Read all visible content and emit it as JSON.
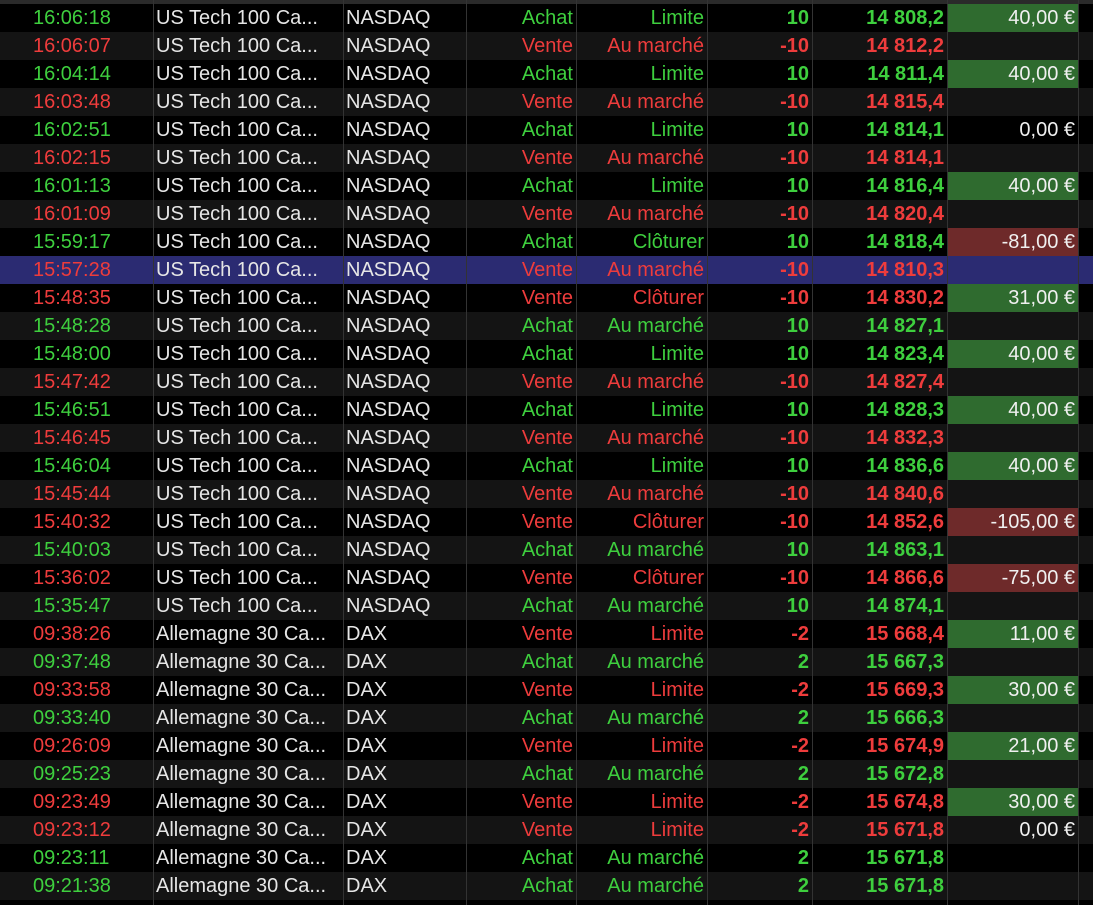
{
  "colors": {
    "buy": "#3ecf3e",
    "sell": "#ee3c3c",
    "profit_bg": "#2f6b2f",
    "loss_bg": "#6e2a2a",
    "selected_row": "#2b2b72"
  },
  "selected_row": 9,
  "rows": [
    {
      "time": "16:06:18",
      "instrument": "US Tech 100 Ca...",
      "market": "NASDAQ",
      "side": "Achat",
      "order_type": "Limite",
      "qty": "10",
      "price": "14 808,2",
      "pnl": "40,00 €",
      "pnl_style": "pos"
    },
    {
      "time": "16:06:07",
      "instrument": "US Tech 100 Ca...",
      "market": "NASDAQ",
      "side": "Vente",
      "order_type": "Au marché",
      "qty": "-10",
      "price": "14 812,2",
      "pnl": "",
      "pnl_style": "none"
    },
    {
      "time": "16:04:14",
      "instrument": "US Tech 100 Ca...",
      "market": "NASDAQ",
      "side": "Achat",
      "order_type": "Limite",
      "qty": "10",
      "price": "14 811,4",
      "pnl": "40,00 €",
      "pnl_style": "pos"
    },
    {
      "time": "16:03:48",
      "instrument": "US Tech 100 Ca...",
      "market": "NASDAQ",
      "side": "Vente",
      "order_type": "Au marché",
      "qty": "-10",
      "price": "14 815,4",
      "pnl": "",
      "pnl_style": "none"
    },
    {
      "time": "16:02:51",
      "instrument": "US Tech 100 Ca...",
      "market": "NASDAQ",
      "side": "Achat",
      "order_type": "Limite",
      "qty": "10",
      "price": "14 814,1",
      "pnl": "0,00 €",
      "pnl_style": "none"
    },
    {
      "time": "16:02:15",
      "instrument": "US Tech 100 Ca...",
      "market": "NASDAQ",
      "side": "Vente",
      "order_type": "Au marché",
      "qty": "-10",
      "price": "14 814,1",
      "pnl": "",
      "pnl_style": "none"
    },
    {
      "time": "16:01:13",
      "instrument": "US Tech 100 Ca...",
      "market": "NASDAQ",
      "side": "Achat",
      "order_type": "Limite",
      "qty": "10",
      "price": "14 816,4",
      "pnl": "40,00 €",
      "pnl_style": "pos"
    },
    {
      "time": "16:01:09",
      "instrument": "US Tech 100 Ca...",
      "market": "NASDAQ",
      "side": "Vente",
      "order_type": "Au marché",
      "qty": "-10",
      "price": "14 820,4",
      "pnl": "",
      "pnl_style": "none"
    },
    {
      "time": "15:59:17",
      "instrument": "US Tech 100 Ca...",
      "market": "NASDAQ",
      "side": "Achat",
      "order_type": "Clôturer",
      "qty": "10",
      "price": "14 818,4",
      "pnl": "-81,00 €",
      "pnl_style": "neg"
    },
    {
      "time": "15:57:28",
      "instrument": "US Tech 100 Ca...",
      "market": "NASDAQ",
      "side": "Vente",
      "order_type": "Au marché",
      "qty": "-10",
      "price": "14 810,3",
      "pnl": "",
      "pnl_style": "none"
    },
    {
      "time": "15:48:35",
      "instrument": "US Tech 100 Ca...",
      "market": "NASDAQ",
      "side": "Vente",
      "order_type": "Clôturer",
      "qty": "-10",
      "price": "14 830,2",
      "pnl": "31,00 €",
      "pnl_style": "pos"
    },
    {
      "time": "15:48:28",
      "instrument": "US Tech 100 Ca...",
      "market": "NASDAQ",
      "side": "Achat",
      "order_type": "Au marché",
      "qty": "10",
      "price": "14 827,1",
      "pnl": "",
      "pnl_style": "none"
    },
    {
      "time": "15:48:00",
      "instrument": "US Tech 100 Ca...",
      "market": "NASDAQ",
      "side": "Achat",
      "order_type": "Limite",
      "qty": "10",
      "price": "14 823,4",
      "pnl": "40,00 €",
      "pnl_style": "pos"
    },
    {
      "time": "15:47:42",
      "instrument": "US Tech 100 Ca...",
      "market": "NASDAQ",
      "side": "Vente",
      "order_type": "Au marché",
      "qty": "-10",
      "price": "14 827,4",
      "pnl": "",
      "pnl_style": "none"
    },
    {
      "time": "15:46:51",
      "instrument": "US Tech 100 Ca...",
      "market": "NASDAQ",
      "side": "Achat",
      "order_type": "Limite",
      "qty": "10",
      "price": "14 828,3",
      "pnl": "40,00 €",
      "pnl_style": "pos"
    },
    {
      "time": "15:46:45",
      "instrument": "US Tech 100 Ca...",
      "market": "NASDAQ",
      "side": "Vente",
      "order_type": "Au marché",
      "qty": "-10",
      "price": "14 832,3",
      "pnl": "",
      "pnl_style": "none"
    },
    {
      "time": "15:46:04",
      "instrument": "US Tech 100 Ca...",
      "market": "NASDAQ",
      "side": "Achat",
      "order_type": "Limite",
      "qty": "10",
      "price": "14 836,6",
      "pnl": "40,00 €",
      "pnl_style": "pos"
    },
    {
      "time": "15:45:44",
      "instrument": "US Tech 100 Ca...",
      "market": "NASDAQ",
      "side": "Vente",
      "order_type": "Au marché",
      "qty": "-10",
      "price": "14 840,6",
      "pnl": "",
      "pnl_style": "none"
    },
    {
      "time": "15:40:32",
      "instrument": "US Tech 100 Ca...",
      "market": "NASDAQ",
      "side": "Vente",
      "order_type": "Clôturer",
      "qty": "-10",
      "price": "14 852,6",
      "pnl": "-105,00 €",
      "pnl_style": "neg"
    },
    {
      "time": "15:40:03",
      "instrument": "US Tech 100 Ca...",
      "market": "NASDAQ",
      "side": "Achat",
      "order_type": "Au marché",
      "qty": "10",
      "price": "14 863,1",
      "pnl": "",
      "pnl_style": "none"
    },
    {
      "time": "15:36:02",
      "instrument": "US Tech 100 Ca...",
      "market": "NASDAQ",
      "side": "Vente",
      "order_type": "Clôturer",
      "qty": "-10",
      "price": "14 866,6",
      "pnl": "-75,00 €",
      "pnl_style": "neg"
    },
    {
      "time": "15:35:47",
      "instrument": "US Tech 100 Ca...",
      "market": "NASDAQ",
      "side": "Achat",
      "order_type": "Au marché",
      "qty": "10",
      "price": "14 874,1",
      "pnl": "",
      "pnl_style": "none"
    },
    {
      "time": "09:38:26",
      "instrument": "Allemagne 30 Ca...",
      "market": "DAX",
      "side": "Vente",
      "order_type": "Limite",
      "qty": "-2",
      "price": "15 668,4",
      "pnl": "11,00 €",
      "pnl_style": "pos"
    },
    {
      "time": "09:37:48",
      "instrument": "Allemagne 30 Ca...",
      "market": "DAX",
      "side": "Achat",
      "order_type": "Au marché",
      "qty": "2",
      "price": "15 667,3",
      "pnl": "",
      "pnl_style": "none"
    },
    {
      "time": "09:33:58",
      "instrument": "Allemagne 30 Ca...",
      "market": "DAX",
      "side": "Vente",
      "order_type": "Limite",
      "qty": "-2",
      "price": "15 669,3",
      "pnl": "30,00 €",
      "pnl_style": "pos"
    },
    {
      "time": "09:33:40",
      "instrument": "Allemagne 30 Ca...",
      "market": "DAX",
      "side": "Achat",
      "order_type": "Au marché",
      "qty": "2",
      "price": "15 666,3",
      "pnl": "",
      "pnl_style": "none"
    },
    {
      "time": "09:26:09",
      "instrument": "Allemagne 30 Ca...",
      "market": "DAX",
      "side": "Vente",
      "order_type": "Limite",
      "qty": "-2",
      "price": "15 674,9",
      "pnl": "21,00 €",
      "pnl_style": "pos"
    },
    {
      "time": "09:25:23",
      "instrument": "Allemagne 30 Ca...",
      "market": "DAX",
      "side": "Achat",
      "order_type": "Au marché",
      "qty": "2",
      "price": "15 672,8",
      "pnl": "",
      "pnl_style": "none"
    },
    {
      "time": "09:23:49",
      "instrument": "Allemagne 30 Ca...",
      "market": "DAX",
      "side": "Vente",
      "order_type": "Limite",
      "qty": "-2",
      "price": "15 674,8",
      "pnl": "30,00 €",
      "pnl_style": "pos"
    },
    {
      "time": "09:23:12",
      "instrument": "Allemagne 30 Ca...",
      "market": "DAX",
      "side": "Vente",
      "order_type": "Limite",
      "qty": "-2",
      "price": "15 671,8",
      "pnl": "0,00 €",
      "pnl_style": "none"
    },
    {
      "time": "09:23:11",
      "instrument": "Allemagne 30 Ca...",
      "market": "DAX",
      "side": "Achat",
      "order_type": "Au marché",
      "qty": "2",
      "price": "15 671,8",
      "pnl": "",
      "pnl_style": "none"
    },
    {
      "time": "09:21:38",
      "instrument": "Allemagne 30 Ca...",
      "market": "DAX",
      "side": "Achat",
      "order_type": "Au marché",
      "qty": "2",
      "price": "15 671,8",
      "pnl": "",
      "pnl_style": "none"
    }
  ]
}
